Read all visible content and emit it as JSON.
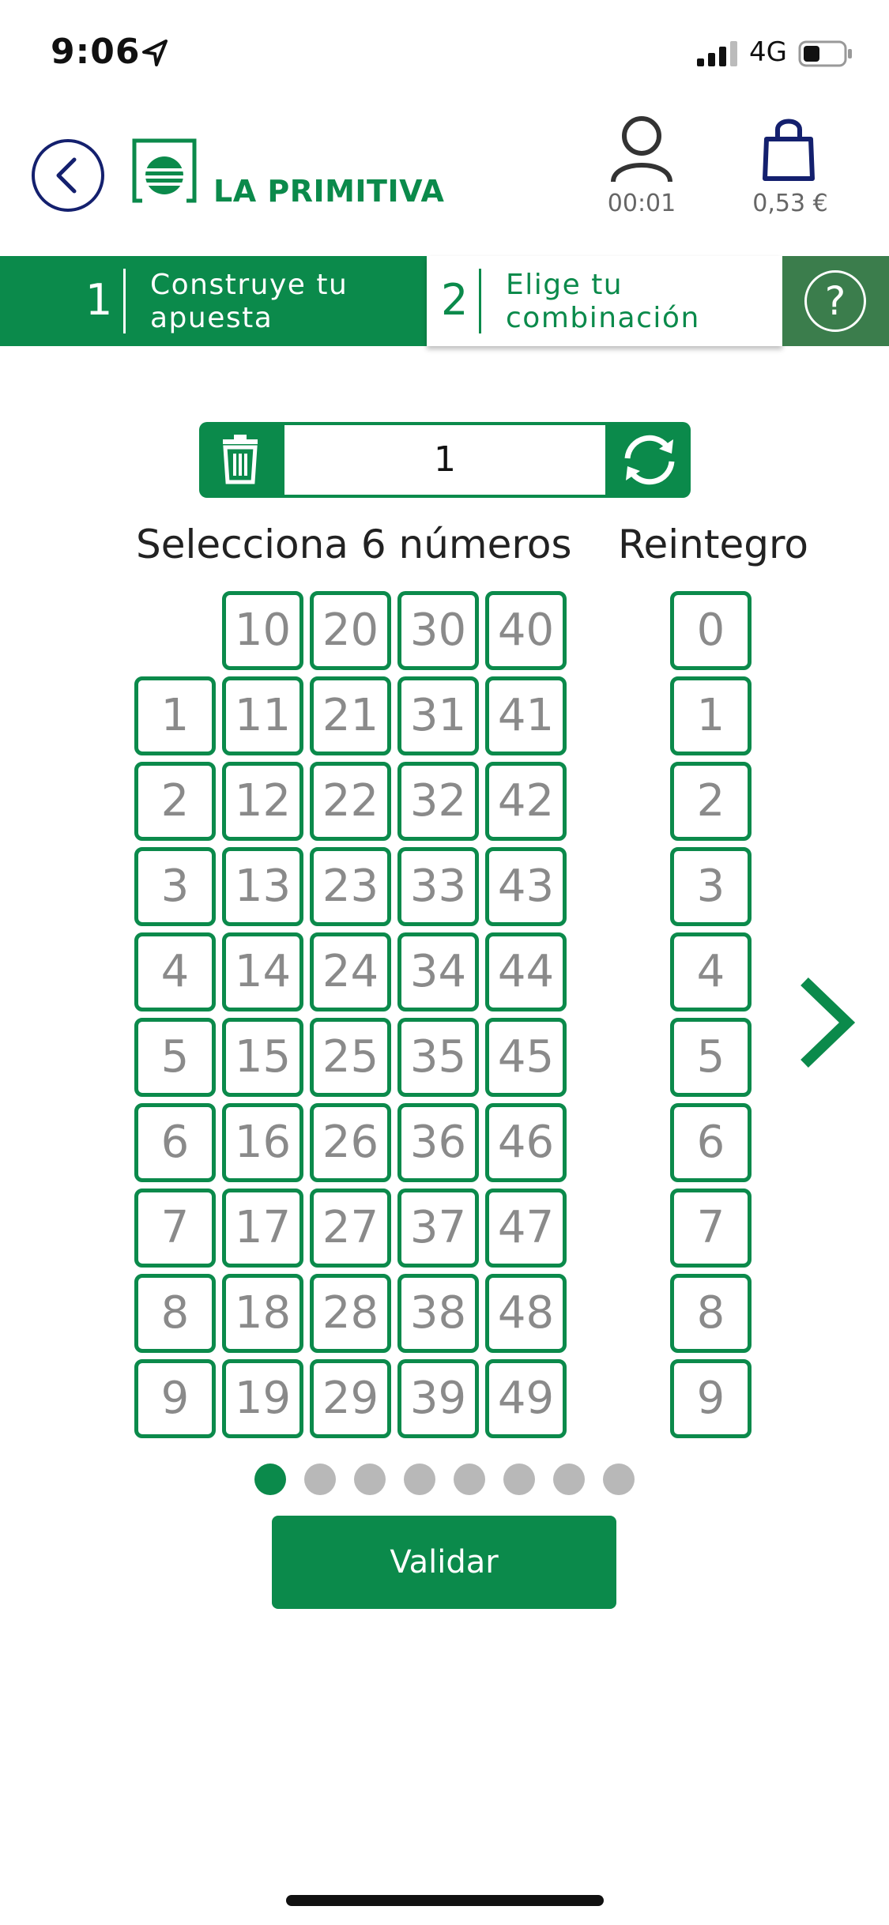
{
  "status_bar": {
    "time": "9:06",
    "network": "4G"
  },
  "header": {
    "logo_text": "LA PRIMITIVA",
    "timer": "00:01",
    "price": "0,53 €"
  },
  "steps": [
    {
      "number": "1",
      "label_line1": "Construye tu",
      "label_line2": "apuesta"
    },
    {
      "number": "2",
      "label_line1": "Elige tu",
      "label_line2": "combinación"
    }
  ],
  "help_symbol": "?",
  "bet_counter": {
    "value": "1"
  },
  "titles": {
    "numbers": "Selecciona 6 números",
    "reintegro": "Reintegro"
  },
  "number_grid": [
    [
      "",
      "10",
      "20",
      "30",
      "40"
    ],
    [
      "1",
      "11",
      "21",
      "31",
      "41"
    ],
    [
      "2",
      "12",
      "22",
      "32",
      "42"
    ],
    [
      "3",
      "13",
      "23",
      "33",
      "43"
    ],
    [
      "4",
      "14",
      "24",
      "34",
      "44"
    ],
    [
      "5",
      "15",
      "25",
      "35",
      "45"
    ],
    [
      "6",
      "16",
      "26",
      "36",
      "46"
    ],
    [
      "7",
      "17",
      "27",
      "37",
      "47"
    ],
    [
      "8",
      "18",
      "28",
      "38",
      "48"
    ],
    [
      "9",
      "19",
      "29",
      "39",
      "49"
    ]
  ],
  "reintegro": [
    "0",
    "1",
    "2",
    "3",
    "4",
    "5",
    "6",
    "7",
    "8",
    "9"
  ],
  "pagination": {
    "total": 8,
    "active": 0
  },
  "validate_label": "Validar",
  "colors": {
    "primary": "#0b8a4b",
    "header_icons": "#14206e",
    "help_bg": "#3b7d4c"
  }
}
